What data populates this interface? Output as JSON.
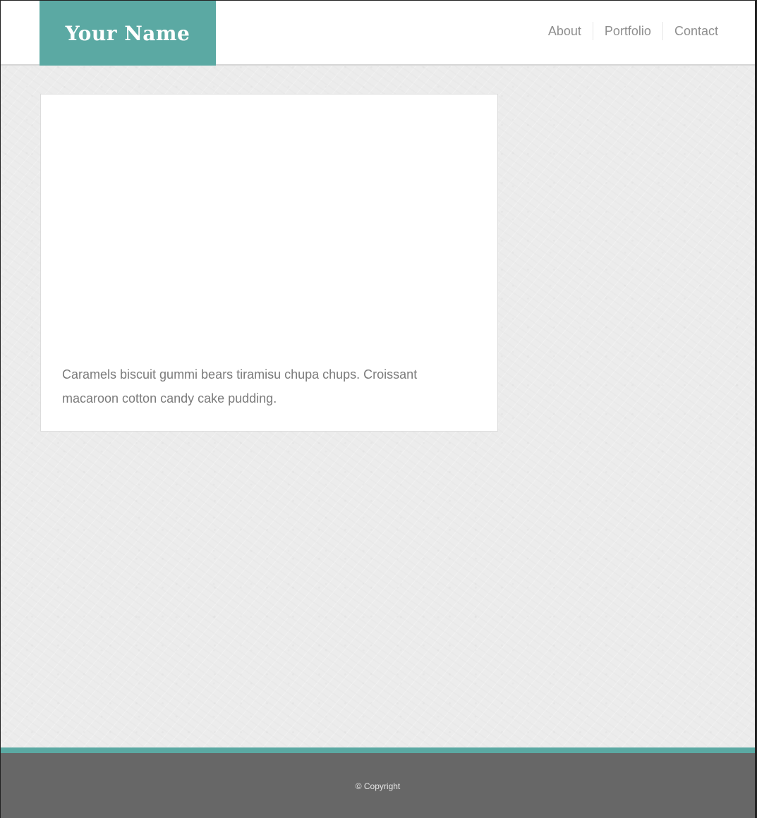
{
  "header": {
    "logo_text": "Your Name",
    "nav": [
      {
        "label": "About"
      },
      {
        "label": "Portfolio"
      },
      {
        "label": "Contact"
      }
    ]
  },
  "card": {
    "text": "Caramels biscuit gummi bears tiramisu chupa chups. Croissant macaroon cotton candy cake pudding."
  },
  "footer": {
    "copyright": "© Copyright"
  },
  "colors": {
    "accent": "#5ba9a3",
    "footer_bg": "#676767",
    "page_bg": "#ececec"
  }
}
